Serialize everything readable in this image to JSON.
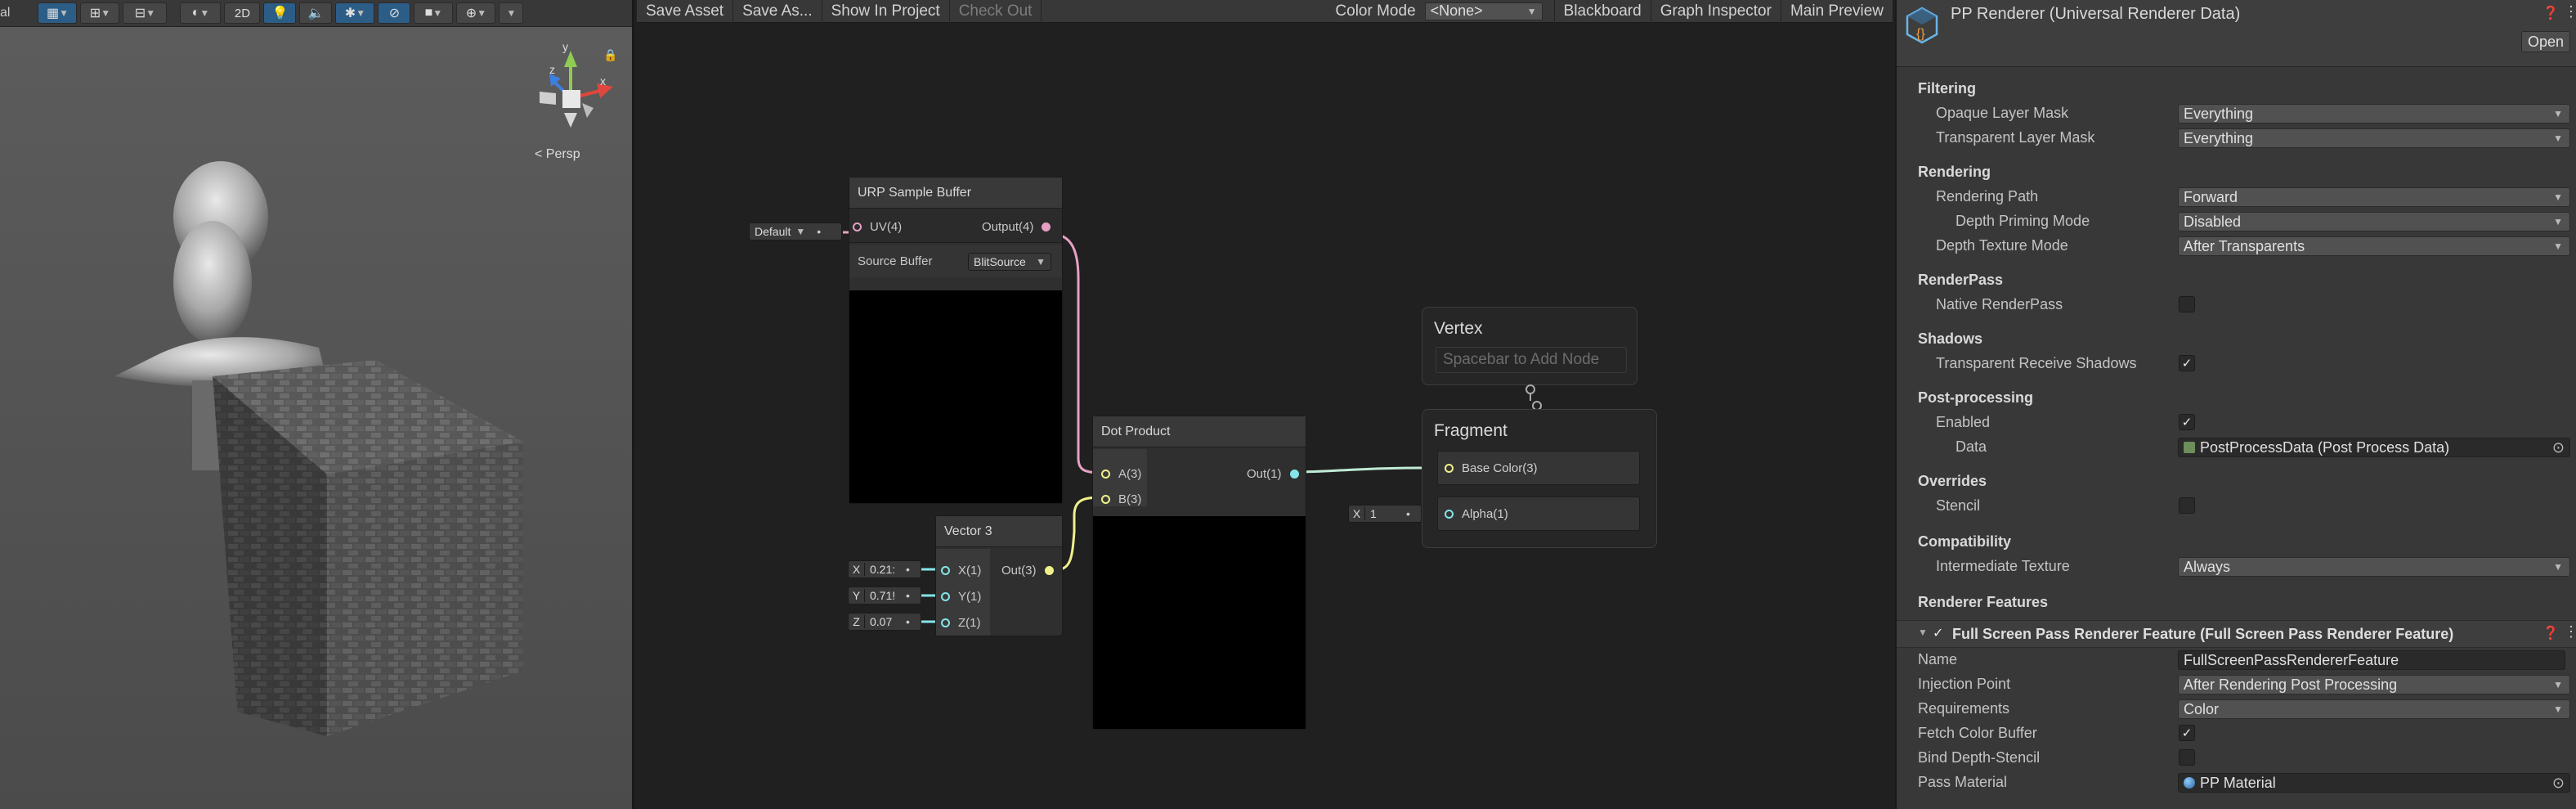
{
  "scene": {
    "toolbar": {
      "mode_2d": "2D",
      "cut_label": "al"
    },
    "gizmo": {
      "axis_y": "y",
      "axis_x": "x",
      "axis_z": "z",
      "persp_label": "< Persp"
    }
  },
  "graph": {
    "toolbar": {
      "save_asset": "Save Asset",
      "save_as": "Save As...",
      "show_in_project": "Show In Project",
      "check_out": "Check Out",
      "color_mode_label": "Color Mode",
      "color_mode_value": "<None>",
      "blackboard": "Blackboard",
      "graph_inspector": "Graph Inspector",
      "main_preview": "Main Preview"
    },
    "urp_node": {
      "title": "URP Sample Buffer",
      "input_uv": "UV(4)",
      "input_default": "Default",
      "output": "Output(4)",
      "source_buffer_label": "Source Buffer",
      "source_buffer_value": "BlitSource"
    },
    "dot_node": {
      "title": "Dot Product",
      "input_a": "A(3)",
      "input_b": "B(3)",
      "output": "Out(1)"
    },
    "vector_node": {
      "title": "Vector 3",
      "input_x": "X(1)",
      "input_y": "Y(1)",
      "input_z": "Z(1)",
      "output": "Out(3)",
      "fields": [
        {
          "axis": "X",
          "value": "0.21:"
        },
        {
          "axis": "Y",
          "value": "0.71!"
        },
        {
          "axis": "Z",
          "value": "0.07"
        }
      ]
    },
    "vertex": {
      "title": "Vertex",
      "hint": "Spacebar to Add Node"
    },
    "fragment": {
      "title": "Fragment",
      "base_color": "Base Color(3)",
      "alpha": "Alpha(1)",
      "alpha_axis": "X",
      "alpha_value": "1"
    }
  },
  "inspector": {
    "title": "PP Renderer (Universal Renderer Data)",
    "open_button": "Open",
    "sections": {
      "filtering": "Filtering",
      "rendering": "Rendering",
      "renderpass": "RenderPass",
      "shadows": "Shadows",
      "postprocessing": "Post-processing",
      "overrides": "Overrides",
      "compatibility": "Compatibility",
      "renderer_features": "Renderer Features"
    },
    "rows": {
      "opaque_layer_mask": {
        "label": "Opaque Layer Mask",
        "value": "Everything"
      },
      "transparent_layer_mask": {
        "label": "Transparent Layer Mask",
        "value": "Everything"
      },
      "rendering_path": {
        "label": "Rendering Path",
        "value": "Forward"
      },
      "depth_priming_mode": {
        "label": "Depth Priming Mode",
        "value": "Disabled"
      },
      "depth_texture_mode": {
        "label": "Depth Texture Mode",
        "value": "After Transparents"
      },
      "native_renderpass": {
        "label": "Native RenderPass"
      },
      "transparent_receive_shadows": {
        "label": "Transparent Receive Shadows"
      },
      "pp_enabled": {
        "label": "Enabled"
      },
      "pp_data": {
        "label": "Data",
        "value": "PostProcessData (Post Process Data)"
      },
      "stencil": {
        "label": "Stencil"
      },
      "intermediate_texture": {
        "label": "Intermediate Texture",
        "value": "Always"
      }
    },
    "feature": {
      "title": "Full Screen Pass Renderer Feature (Full Screen Pass Renderer Feature)",
      "name": {
        "label": "Name",
        "value": "FullScreenPassRendererFeature"
      },
      "injection_point": {
        "label": "Injection Point",
        "value": "After Rendering Post Processing"
      },
      "requirements": {
        "label": "Requirements",
        "value": "Color"
      },
      "fetch_color_buffer": {
        "label": "Fetch Color Buffer"
      },
      "bind_depth_stencil": {
        "label": "Bind Depth-Stencil"
      },
      "pass_material": {
        "label": "Pass Material",
        "value": "PP Material"
      }
    },
    "checkmark": "✓"
  },
  "colors": {
    "uv_wire": "#e7a0c4",
    "vec3_wire": "#f0f08a",
    "float_wire": "#84e4e7",
    "accent_blue": "#2c5d87"
  }
}
